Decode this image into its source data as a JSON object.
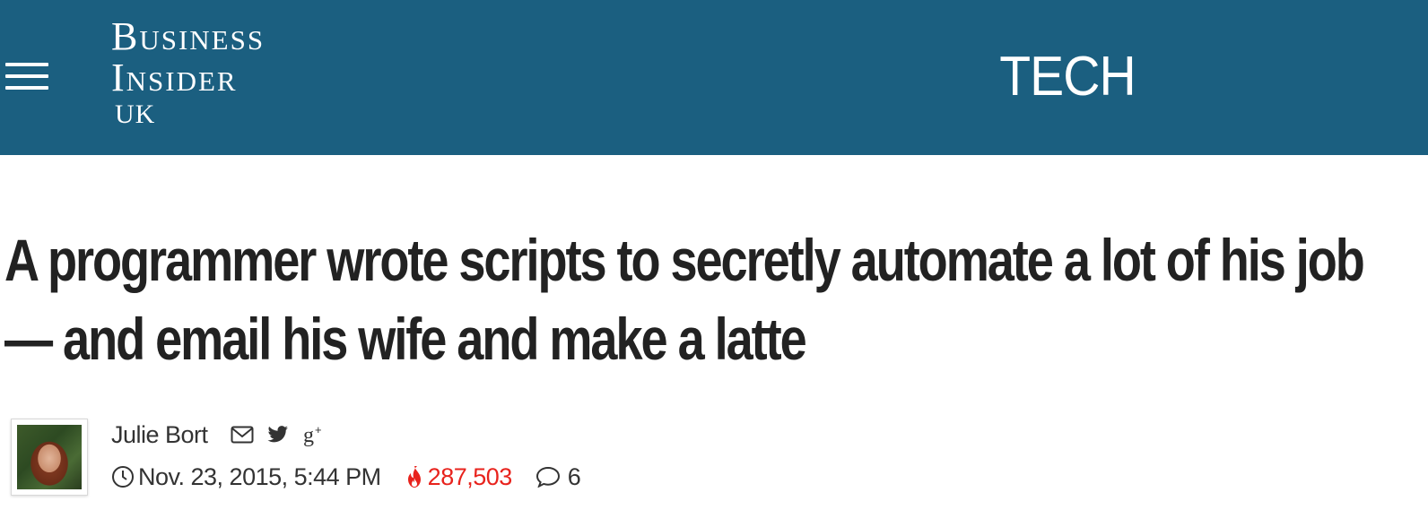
{
  "header": {
    "logo": {
      "line1": "Business",
      "line2": "Insider",
      "line3": "UK"
    },
    "section": "TECH",
    "background_color": "#1b5f80"
  },
  "article": {
    "headline": "A programmer wrote scripts to secretly automate a lot of his job — and email his wife and make a latte",
    "author": "Julie Bort",
    "date": "Nov. 23, 2015, 5:44 PM",
    "views": "287,503",
    "comments": "6",
    "views_color": "#e8231d"
  },
  "icons": {
    "menu": "hamburger-menu-icon",
    "email": "email-icon",
    "twitter": "twitter-icon",
    "google_plus": "google-plus-icon",
    "clock": "clock-icon",
    "views": "flame-icon",
    "comments": "comment-bubble-icon"
  }
}
